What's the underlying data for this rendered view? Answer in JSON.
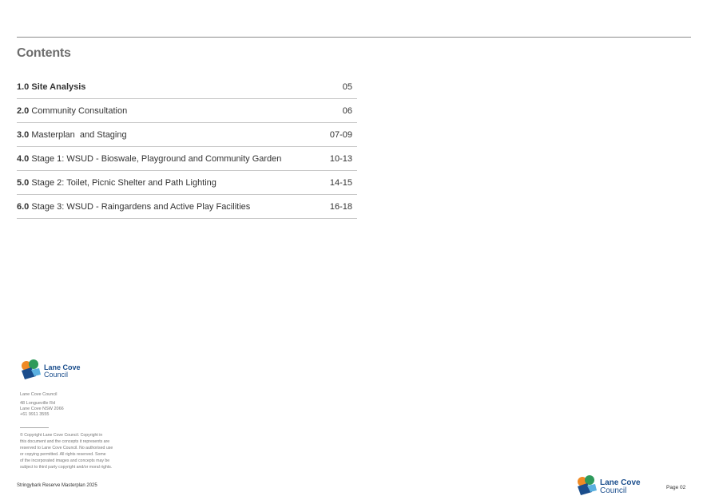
{
  "contents": {
    "title": "Contents",
    "items": [
      {
        "num": "1.0",
        "name": "Site Analysis",
        "page": "05"
      },
      {
        "num": "2.0",
        "name": "Community Consultation",
        "page": "06"
      },
      {
        "num": "3.0",
        "name": "Masterplan  and Staging",
        "page": "07-09"
      },
      {
        "num": "4.0",
        "name": "Stage 1: WSUD - Bioswale, Playground and Community Garden",
        "page": "10-13"
      },
      {
        "num": "5.0",
        "name": "Stage 2: Toilet, Picnic Shelter and Path Lighting",
        "page": "14-15"
      },
      {
        "num": "6.0",
        "name": "Stage 3: WSUD - Raingardens and Active Play Facilities",
        "page": "16-18"
      }
    ]
  },
  "logo": {
    "line1": "Lane Cove",
    "line2": "Council"
  },
  "address": {
    "org": "Lane Cove Council",
    "street": "48 Longueville Rd",
    "suburb": "Lane Cove NSW 2066",
    "phone": "+61 9911 3555"
  },
  "copyright": {
    "line1": "© Copyright Lane Cove Council. Copyright in",
    "line2": "this document and the concepts it represents are",
    "line3": "reserved to Lane Cove Council. No authorised use",
    "line4": "or copying permitted. All rights reserved. Some",
    "line5": "of the incorporated images and concepts may be",
    "line6": "subject to third party copyright and/or moral rights."
  },
  "footer": {
    "doc_title": "Stringybark Reserve Masterplan 2025",
    "page": "Page 02"
  },
  "colors": {
    "logo_blue": "#1a4d8c",
    "logo_green": "#2e9a5b",
    "logo_orange": "#f08a24"
  }
}
